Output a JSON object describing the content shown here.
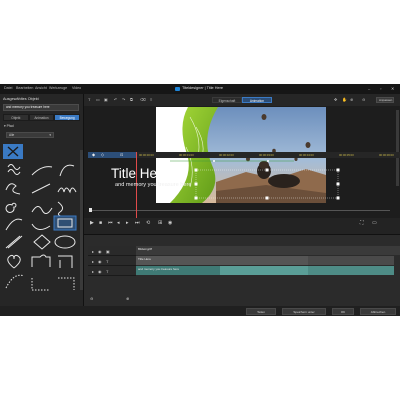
{
  "menu": {
    "items": [
      "Datei",
      "Bearbeiten",
      "Ansicht",
      "Werkzeuge",
      "Video"
    ],
    "app_title": "Titeldesigner  |  Title Here"
  },
  "left_panel": {
    "title": "Ausgewähltes Objekt",
    "path_text": "and memory you treasure here",
    "tabs": [
      {
        "label": "Objekt"
      },
      {
        "label": "Animation"
      },
      {
        "label": "Bewegung"
      }
    ],
    "category": "Pfad",
    "filter": "Alle"
  },
  "toolbar": {
    "segments": [
      "Eigenschaft",
      "Animation"
    ],
    "zoom": "Anpassen"
  },
  "preview": {
    "title": "Title Here",
    "subtitle": "and memory you treasure here"
  },
  "timeline": {
    "ticks": [
      "00:00:00:00",
      "00:00:01:00",
      "00:00:02:00",
      "00:00:03:00",
      "00:00:04:00",
      "00:00:05:00",
      "00:00:06:00"
    ],
    "tracks": [
      {
        "clip": "Bildeingriff"
      },
      {
        "clip": "Title Here"
      },
      {
        "clip": "and memory you treasure here"
      }
    ]
  },
  "bottom_buttons": [
    "Teilen",
    "Speichern unter",
    "OK",
    "Abbrechen"
  ],
  "colors": {
    "accent": "#3a7ac4",
    "ruler_text": "#c8b84a",
    "playhead": "#e04a4a",
    "teal_clip": "#4e8c86"
  }
}
